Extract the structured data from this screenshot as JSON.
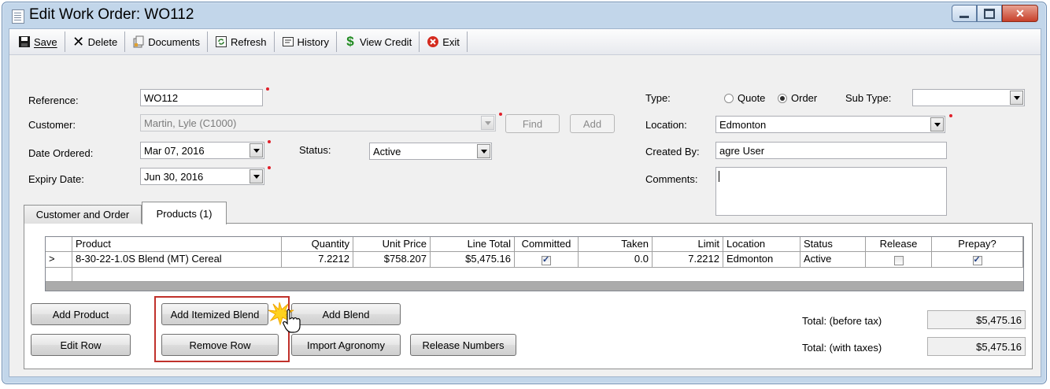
{
  "window": {
    "title": "Edit Work Order: WO112"
  },
  "toolbar": {
    "save": "Save",
    "delete": "Delete",
    "documents": "Documents",
    "refresh": "Refresh",
    "history": "History",
    "view_credit": "View Credit",
    "exit": "Exit"
  },
  "form": {
    "reference_label": "Reference:",
    "reference_value": "WO112",
    "customer_label": "Customer:",
    "customer_value": "Martin, Lyle (C1000)",
    "find_label": "Find",
    "add_label": "Add",
    "date_ordered_label": "Date Ordered:",
    "date_ordered_value": "Mar 07, 2016",
    "status_label": "Status:",
    "status_value": "Active",
    "expiry_label": "Expiry Date:",
    "expiry_value": "Jun 30, 2016",
    "type_label": "Type:",
    "type_quote": "Quote",
    "type_order": "Order",
    "type_selected": "Order",
    "subtype_label": "Sub Type:",
    "subtype_value": "",
    "location_label": "Location:",
    "location_value": "Edmonton",
    "created_by_label": "Created By:",
    "created_by_value": "agre User",
    "comments_label": "Comments:",
    "comments_value": ""
  },
  "tabs": [
    {
      "label": "Customer and Order",
      "active": false
    },
    {
      "label": "Products (1)",
      "active": true
    }
  ],
  "grid": {
    "columns": [
      "",
      "Product",
      "Quantity",
      "Unit Price",
      "Line Total",
      "Committed",
      "Taken",
      "Limit",
      "Location",
      "Status",
      "Release",
      "Prepay?"
    ],
    "rows": [
      {
        "indicator": ">",
        "product": "8-30-22-1.0S Blend (MT)  Cereal",
        "quantity": "7.2212",
        "unit_price": "$758.207",
        "line_total": "$5,475.16",
        "committed": true,
        "taken": "0.0",
        "limit": "7.2212",
        "location": "Edmonton",
        "status": "Active",
        "release": false,
        "prepay": true
      }
    ]
  },
  "actions": {
    "add_product": "Add Product",
    "add_itemized_blend": "Add Itemized Blend",
    "add_blend": "Add Blend",
    "edit_row": "Edit Row",
    "remove_row": "Remove Row",
    "import_agronomy": "Import Agronomy",
    "release_numbers": "Release Numbers"
  },
  "totals": {
    "before_tax_label": "Total: (before tax)",
    "before_tax_value": "$5,475.16",
    "with_taxes_label": "Total: (with taxes)",
    "with_taxes_value": "$5,475.16"
  },
  "colors": {
    "required_marker": "#e0202a",
    "highlight_border": "#c0312b",
    "title_bar": "#c2d6ea"
  }
}
